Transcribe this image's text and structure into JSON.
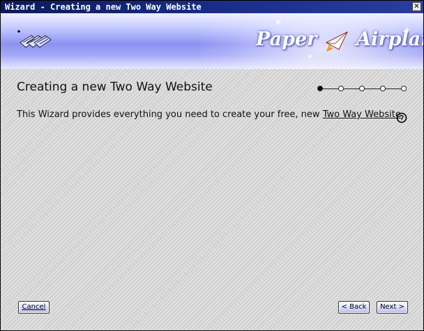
{
  "window": {
    "title": "Wizard - Creating a new Two Way Website",
    "close_symbol": "✕"
  },
  "banner": {
    "icon": "wizard-pages-icon",
    "brand_left": "Paper",
    "brand_right": "Airplane",
    "brand_icon": "paper-airplane-logo-icon"
  },
  "content": {
    "heading": "Creating a new Two Way Website",
    "description_prefix": "This Wizard provides everything you need to create your free, new ",
    "description_link": "Two Way Website",
    "steps": {
      "total": 5,
      "current": 1
    }
  },
  "buttons": {
    "cancel": "Cancel",
    "back": "< Back",
    "next": "Next >"
  },
  "colors": {
    "titlebar": "#0a1a5c",
    "banner_accent": "#8d92f2",
    "button_fill": "#b6bcf0"
  }
}
